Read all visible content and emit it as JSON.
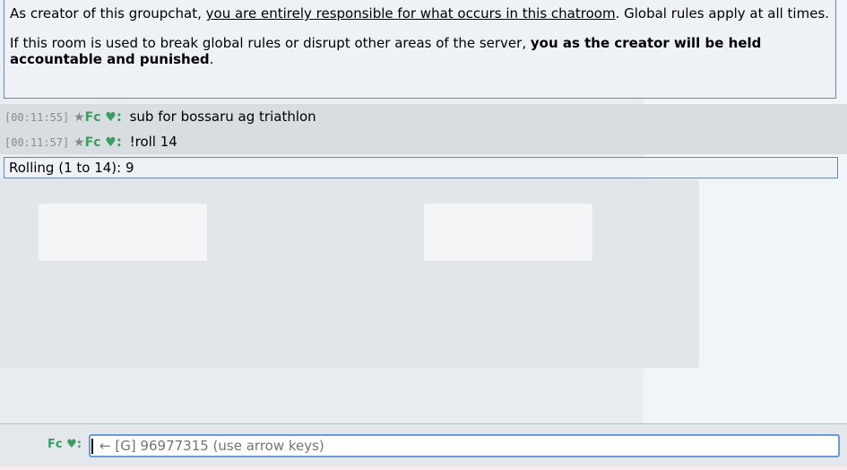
{
  "notice": {
    "p1_before": "As creator of this groupchat, ",
    "p1_link": "you are entirely responsible for what occurs in this chatroom",
    "p1_after": ". Global rules apply at all times.",
    "p2_before": "If this room is used to break global rules or disrupt other areas of the server, ",
    "p2_bold": "you as the creator will be held accountable and punished",
    "p2_after": "."
  },
  "messages": [
    {
      "timestamp": "[00:11:55]",
      "rank": "★",
      "user": "Fc",
      "heart": "♥",
      "colon": ":",
      "text": "sub for bossaru ag triathlon"
    },
    {
      "timestamp": "[00:11:57]",
      "rank": "★",
      "user": "Fc",
      "heart": "♥",
      "colon": ":",
      "text": "!roll 14"
    }
  ],
  "roll_result": "Rolling (1 to 14): 9",
  "footer": {
    "user": "Fc",
    "heart": "♥",
    "colon": ":",
    "input_placeholder": "← [G] 96977315 (use arrow keys)"
  },
  "colors": {
    "username": "#3a9d5f",
    "border": "#6c86a6",
    "input_focus": "#6c9ad8"
  }
}
